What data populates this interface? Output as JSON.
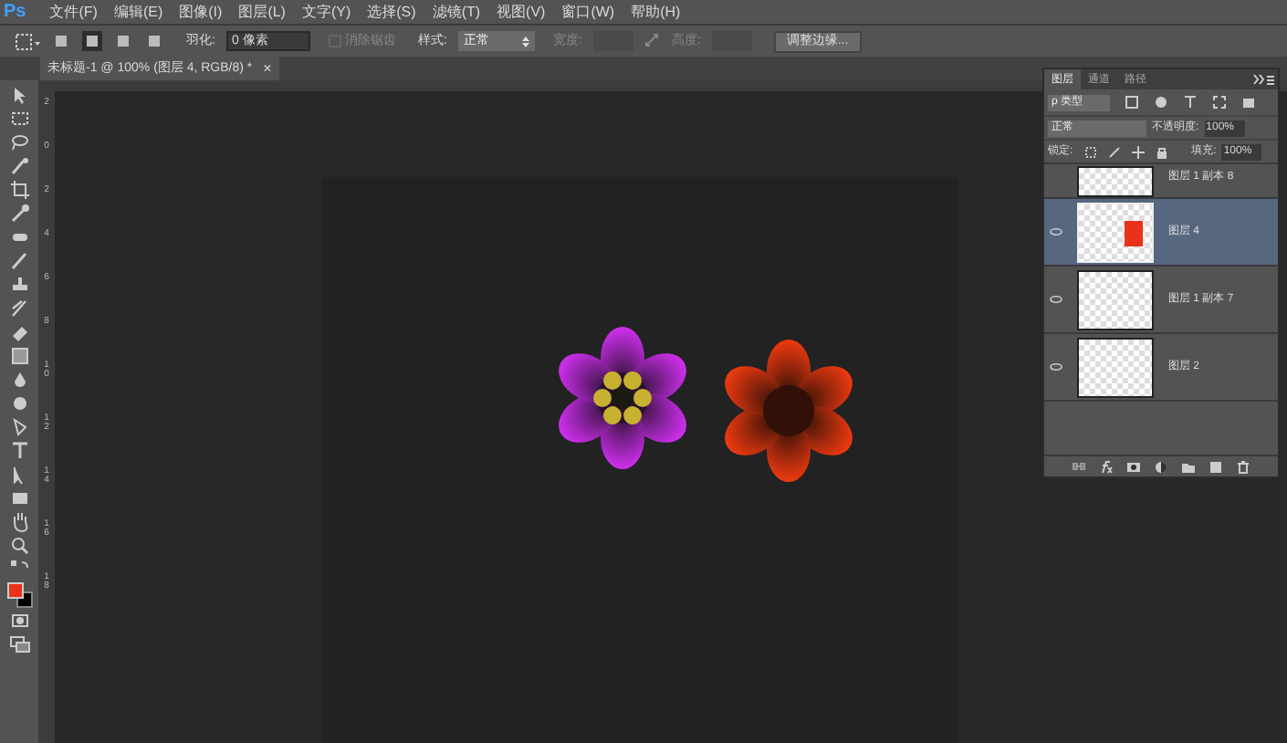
{
  "menu_bar": {
    "logo": "Ps",
    "items": [
      "文件(F)",
      "编辑(E)",
      "图像(I)",
      "图层(L)",
      "文字(Y)",
      "选择(S)",
      "滤镜(T)",
      "视图(V)",
      "窗口(W)",
      "帮助(H)"
    ]
  },
  "options_bar": {
    "modes": [
      {
        "selected": false
      },
      {
        "selected": true
      },
      {
        "selected": false
      },
      {
        "selected": false
      }
    ],
    "feather_label": "羽化:",
    "feather_value": "0 像素",
    "antialias": {
      "label": "消除锯齿",
      "checked": false,
      "disabled": true
    },
    "style_label": "样式:",
    "style_value": "正常",
    "width_label": "宽度:",
    "height_label": "高度:",
    "refine_button": "调整边缘..."
  },
  "document_tab": {
    "title": "未标题-1 @ 100% (图层 4, RGB/8) *",
    "close": "×"
  },
  "vertical_ruler": [
    "2",
    "0",
    "2",
    "4",
    "6",
    "8",
    "1 0",
    "1 2",
    "1 4",
    "1 6",
    "1 8"
  ],
  "tools": {
    "swatches": [
      {
        "kind": "foreground",
        "color": "#e8321a"
      },
      {
        "kind": "background",
        "color": "#000000"
      }
    ]
  },
  "layers_panel": {
    "tabs": [
      {
        "label": "图层",
        "selected": true
      },
      {
        "label": "通道",
        "selected": false
      },
      {
        "label": "路径",
        "selected": false
      }
    ],
    "filter_label": "ρ 类型",
    "blend_mode": "正常",
    "opacity_label": "不透明度:",
    "opacity_value": "100%",
    "lock_label": "锁定:",
    "fill_label": "填充:",
    "fill_value": "100%",
    "layers": [
      {
        "name": "图层 1 副本 8",
        "selected": false,
        "visible": false,
        "kind": "empty"
      },
      {
        "name": "图层 4",
        "selected": true,
        "visible": true,
        "kind": "shape"
      },
      {
        "name": "图层 1 副本 7",
        "selected": false,
        "visible": true,
        "kind": "empty"
      },
      {
        "name": "图层 2",
        "selected": false,
        "visible": true,
        "kind": "empty"
      }
    ]
  }
}
